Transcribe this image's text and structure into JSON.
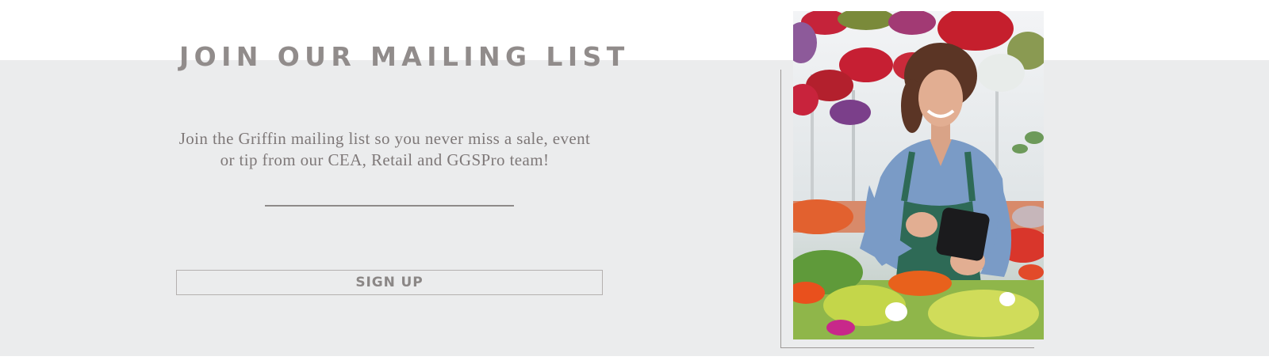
{
  "mailing_list": {
    "heading": "JOIN OUR MAILING LIST",
    "description": "Join the Griffin mailing list so you never miss a sale, event or tip from our CEA, Retail and GGSPro team!",
    "signup_label": "SIGN UP"
  },
  "photo": {
    "icon": "woman-with-tablet-in-greenhouse-photo"
  },
  "colors": {
    "band": "#ebeced",
    "heading": "#918c8b",
    "body_text": "#7e7878"
  }
}
